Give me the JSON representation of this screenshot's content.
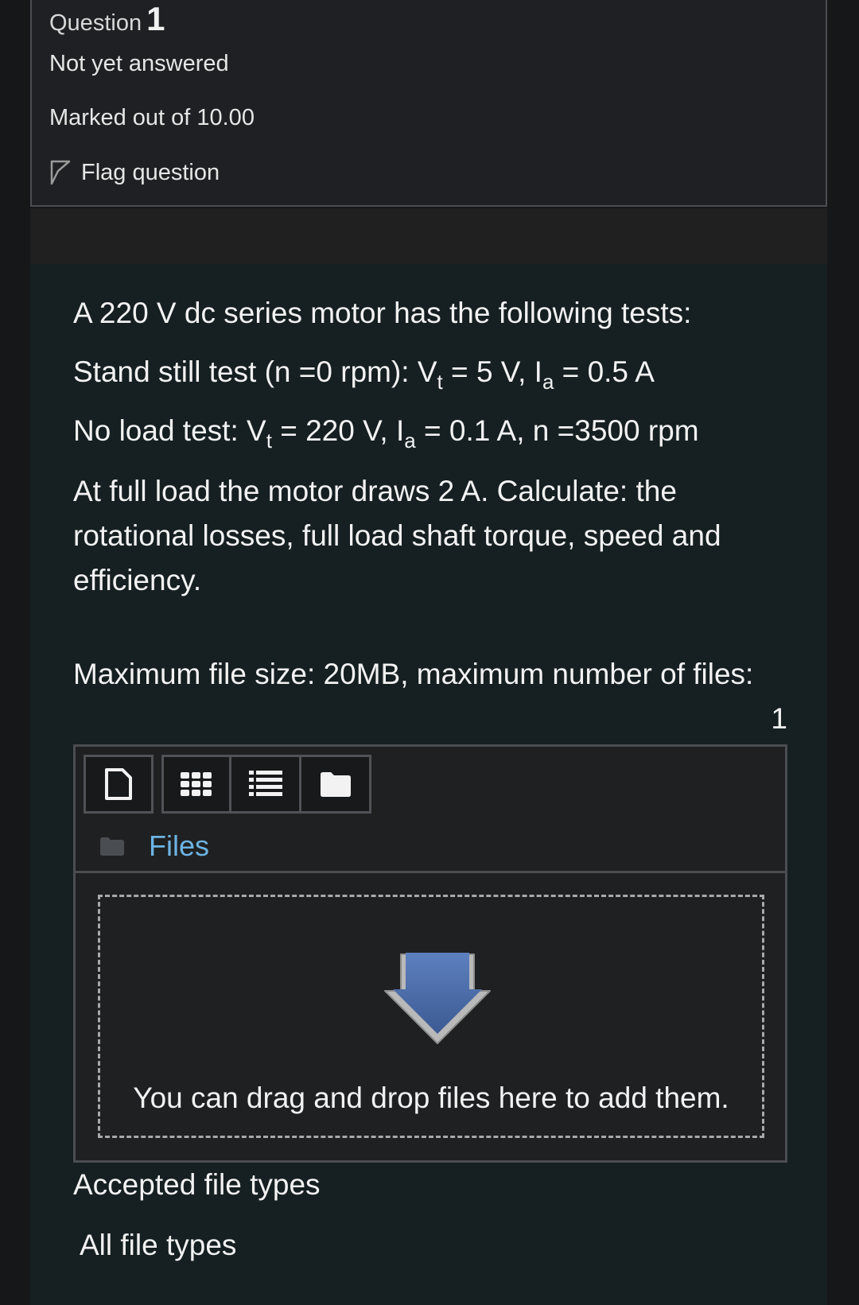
{
  "info": {
    "question_label": "Question",
    "question_number": "1",
    "state": "Not yet answered",
    "marks": "Marked out of 10.00",
    "flag_label": "Flag question"
  },
  "question": {
    "line1": "A 220 V  dc series motor  has the following tests:",
    "line2": {
      "prefix": "Stand still test (n =0 rpm): V",
      "sub1": "t",
      "mid": " = 5 V, I",
      "sub2": "a",
      "suffix": " = 0.5 A"
    },
    "line3": {
      "prefix": "No load test: V",
      "sub1": "t",
      "mid": " = 220 V, I",
      "sub2": "a",
      "suffix": " = 0.1 A, n =3500 rpm"
    },
    "line4": "At full load the motor draws 2 A. Calculate: the rotational losses, full load shaft torque, speed and efficiency."
  },
  "upload": {
    "limits_text": "Maximum file size: 20MB, maximum number of files:",
    "max_files": "1",
    "toolbar": {
      "add_file_icon": "file-add-icon",
      "icons_view_icon": "grid-view-icon",
      "list_view_icon": "list-view-icon",
      "tree_view_icon": "folder-view-icon"
    },
    "path_label": "Files",
    "drop_text": "You can drag and drop files here to add them.",
    "accepted_label": "Accepted file types",
    "accepted_value": "All file types"
  },
  "colors": {
    "link": "#6cb4e4",
    "arrow": "#4b6aa3",
    "background": "#161f22"
  }
}
